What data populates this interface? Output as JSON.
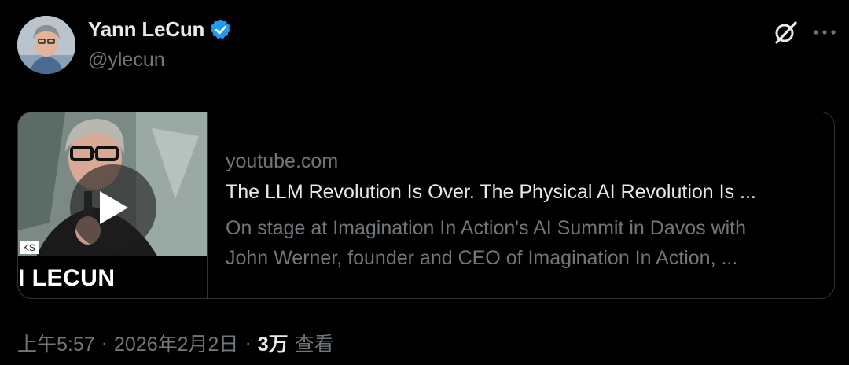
{
  "tweet": {
    "author": {
      "display_name": "Yann LeCun",
      "handle": "@ylecun",
      "verified_icon": "verified-badge-icon",
      "verified_color": "#1d9bf0"
    },
    "actions": {
      "grok_icon": "grok-icon",
      "more_icon": "more-horizontal-icon"
    },
    "link_card": {
      "domain": "youtube.com",
      "title": "The LLM Revolution Is Over. The Physical AI Revolution Is ...",
      "description_line1": "On stage at Imagination In Action's AI Summit in Davos with",
      "description_line2": "John Werner, founder and CEO of Imagination In Action, ...",
      "thumbnail": {
        "small_caption": "KS",
        "banner_text": "I LECUN",
        "play_icon": "play-icon"
      }
    },
    "meta": {
      "time": "上午5:57",
      "dot1": "·",
      "date": "2026年2月2日",
      "dot2": "·",
      "views_count": "3万",
      "views_label": "查看"
    }
  }
}
